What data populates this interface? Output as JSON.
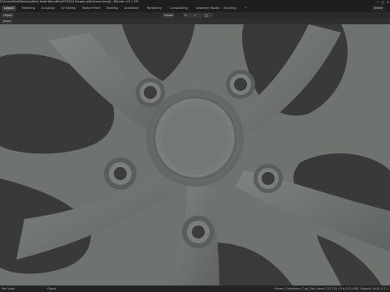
{
  "window": {
    "title": "D:\\Users\\Nati\\Desktop\\New folder\\BlendProf3T\\3524 Forged_withScene.blend] - Blender 4.2.1 LTS",
    "minimize": "—",
    "maximize": "□",
    "close": "✕"
  },
  "workspace_tabs": [
    "Layout",
    "Modeling",
    "Sculpting",
    "UV Editing",
    "Texture Paint",
    "Shading",
    "Animation",
    "Rendering",
    "Compositing",
    "Geometry Nodes",
    "Scripting"
  ],
  "active_tab": "Layout",
  "add_tab": "+",
  "scene_field": "Scene",
  "header": {
    "transform_orientation": "Global",
    "object_mode": "Object"
  },
  "viewport_toolbar": {
    "select_box": "Select"
  },
  "status": {
    "left": "Pan View",
    "mid": "Object",
    "right": "Scene | Collection | Cap_Flat | Verts 121,754 | Tris 243,438 | Objects 1/48 | 4.2.1"
  },
  "colors": {
    "rim_base": "#6f7470",
    "background": "#3d3d3d",
    "header": "#1e1e1e"
  }
}
